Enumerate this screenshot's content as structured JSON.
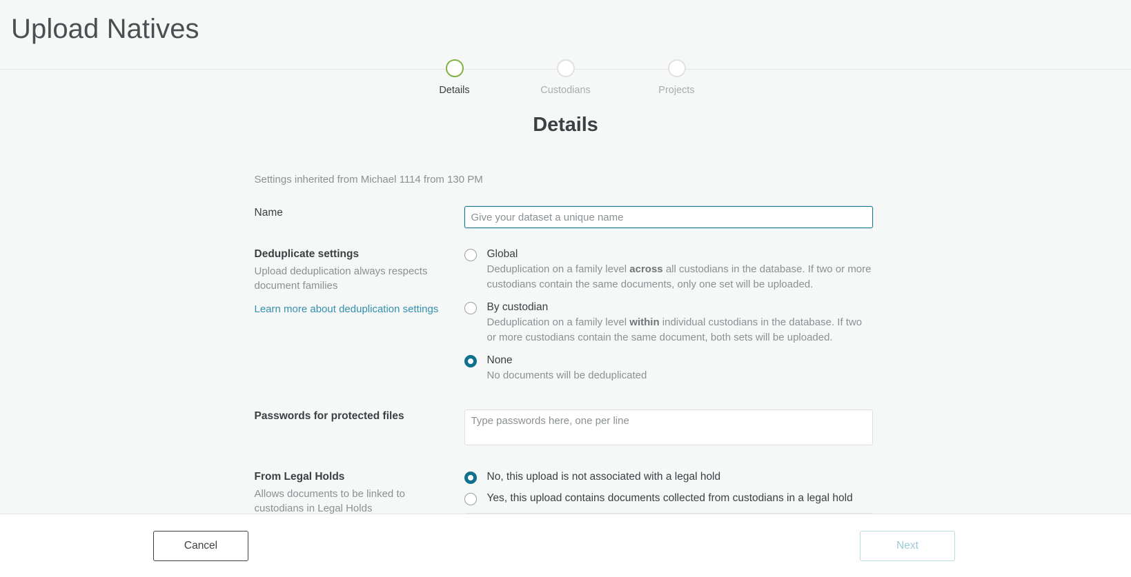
{
  "header": {
    "title": "Upload Natives"
  },
  "stepper": {
    "steps": [
      {
        "label": "Details",
        "state": "active"
      },
      {
        "label": "Custodians",
        "state": "inactive"
      },
      {
        "label": "Projects",
        "state": "inactive"
      }
    ],
    "active_color": "#7fb241",
    "inactive_color": "#e0e2e2"
  },
  "main": {
    "section_title": "Details",
    "inherited_note": "Settings inherited from Michael 1114 from 130 PM",
    "name": {
      "label": "Name",
      "value": "",
      "placeholder": "Give your dataset a unique name",
      "focus_border_color": "#17788f"
    },
    "deduplicate": {
      "label": "Deduplicate settings",
      "help": "Upload deduplication always respects document families",
      "link": "Learn more about deduplication settings",
      "link_color": "#3190ae",
      "options": [
        {
          "label": "Global",
          "selected": false,
          "desc_before": "Deduplication on a family level ",
          "desc_bold": "across",
          "desc_after": " all custodians in the database. If two or more custodians contain the same documents, only one set will be uploaded."
        },
        {
          "label": "By custodian",
          "selected": false,
          "desc_before": "Deduplication on a family level ",
          "desc_bold": "within",
          "desc_after": " individual custodians in the database. If two or more custodians contain the same document, both sets will be uploaded."
        },
        {
          "label": "None",
          "selected": true,
          "desc_before": "No documents will be deduplicated",
          "desc_bold": "",
          "desc_after": ""
        }
      ]
    },
    "passwords": {
      "label": "Passwords for protected files",
      "value": "",
      "placeholder": "Type passwords here, one per line"
    },
    "legal_holds": {
      "label": "From Legal Holds",
      "help": "Allows documents to be linked to custodians in Legal Holds",
      "options": [
        {
          "label": "No, this upload is not associated with a legal hold",
          "selected": true
        },
        {
          "label": "Yes, this upload contains documents collected from custodians in a legal hold",
          "selected": false
        }
      ]
    },
    "selected_radio_color": "#10718e"
  },
  "footer": {
    "cancel_label": "Cancel",
    "next_label": "Next",
    "next_disabled": true
  }
}
